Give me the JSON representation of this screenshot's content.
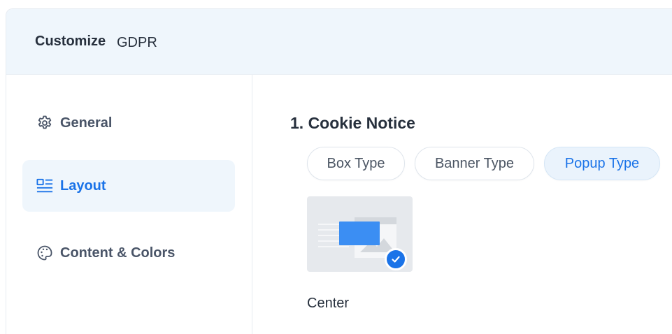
{
  "header": {
    "title": "Customize",
    "subtitle": "GDPR"
  },
  "sidebar": {
    "items": [
      {
        "label": "General",
        "icon": "gear-icon",
        "active": false
      },
      {
        "label": "Layout",
        "icon": "layout-icon",
        "active": true
      },
      {
        "label": "Content & Colors",
        "icon": "palette-icon",
        "active": false
      }
    ]
  },
  "main": {
    "section_title": "1. Cookie Notice",
    "types": [
      {
        "label": "Box Type",
        "active": false
      },
      {
        "label": "Banner Type",
        "active": false
      },
      {
        "label": "Popup Type",
        "active": true
      }
    ],
    "layout_options": [
      {
        "label": "Center",
        "selected": true
      }
    ]
  },
  "colors": {
    "accent": "#1a73e8",
    "header_bg": "#eff6fc",
    "active_bg": "#eff6fc"
  }
}
